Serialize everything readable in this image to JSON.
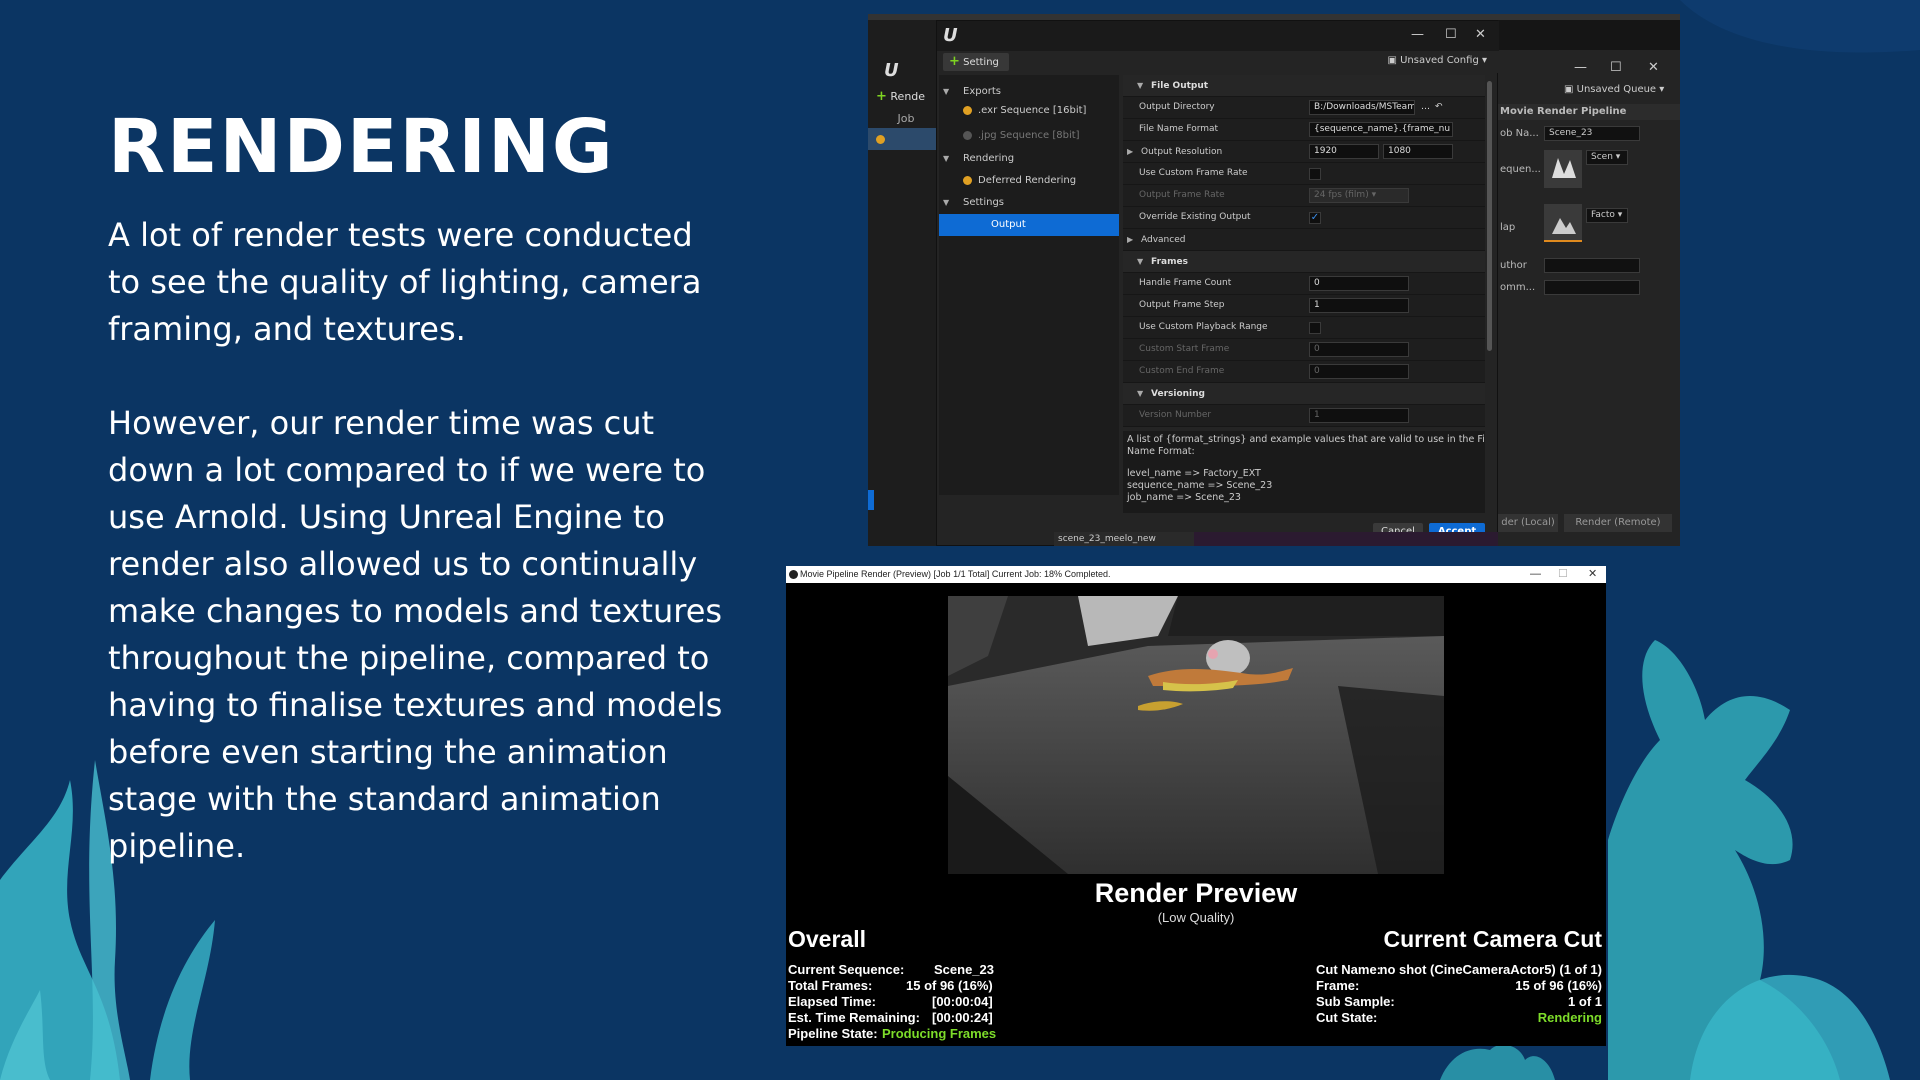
{
  "slide": {
    "title": "RENDERING",
    "paragraph1": "A lot of render tests were conducted to see the quality of lighting, camera framing, and textures.",
    "paragraph2": "However, our render time was cut down a lot compared to if we were to use Arnold. Using Unreal Engine to render also allowed us to continually make changes to models and textures throughout the pipeline, compared to having to finalise textures and models before even starting the animation stage with the standard animation pipeline."
  },
  "colors": {
    "background": "#0b3563",
    "accent": "#0e6bd4",
    "green": "#7ddc2a",
    "seaweed": "#3ab7c9"
  },
  "back_window": {
    "render_btn": "Rende",
    "job_header": "Job",
    "queue_label": "Unsaved Queue",
    "panel_title": "Movie Render Pipeline",
    "job_name_label": "ob Na...",
    "job_name_value": "Scene_23",
    "sequence_label": "equen...",
    "scene_dd": "Scen",
    "map_label": "lap",
    "factory_dd": "Facto",
    "author_label": "uthor",
    "comment_label": "omm...",
    "render_local": "der (Local)",
    "render_remote": "Render (Remote)",
    "bottom_text": "scene_23_meelo_new"
  },
  "dialog": {
    "setting_button": "Setting",
    "config_label": "Unsaved Config",
    "tree": {
      "exports": "Exports",
      "exr": ".exr Sequence [16bit]",
      "jpg": ".jpg Sequence [8bit]",
      "rendering": "Rendering",
      "deferred": "Deferred Rendering",
      "settings": "Settings",
      "output": "Output"
    },
    "props": {
      "file_output": "File Output",
      "output_directory": "Output Directory",
      "output_directory_value": "B:/Downloads/MSTeams/N",
      "file_name_format": "File Name Format",
      "file_name_format_value": "{sequence_name}.{frame_nu",
      "output_resolution": "Output Resolution",
      "res_w": "1920",
      "res_h": "1080",
      "use_custom_frame_rate": "Use Custom Frame Rate",
      "output_frame_rate": "Output Frame Rate",
      "output_frame_rate_value": "24 fps (film)",
      "override_existing_output": "Override Existing Output",
      "advanced": "Advanced",
      "frames": "Frames",
      "handle_frame_count": "Handle Frame Count",
      "handle_frame_count_value": "0",
      "output_frame_step": "Output Frame Step",
      "output_frame_step_value": "1",
      "use_custom_playback_range": "Use Custom Playback Range",
      "custom_start_frame": "Custom Start Frame",
      "custom_start_frame_value": "0",
      "custom_end_frame": "Custom End Frame",
      "custom_end_frame_value": "0",
      "versioning": "Versioning",
      "version_number": "Version Number",
      "version_number_value": "1"
    },
    "description": {
      "line1": "A list of {format_strings} and example values that are valid to use in the File",
      "line2": "Name Format:",
      "line3": "level_name => Factory_EXT",
      "line4": "sequence_name => Scene_23",
      "line5": "job_name => Scene_23"
    },
    "cancel": "Cancel",
    "accept": "Accept"
  },
  "preview": {
    "window_title": "Movie Pipeline Render (Preview) [Job 1/1 Total] Current Job: 18% Completed.",
    "title": "Render Preview",
    "subtitle": "(Low Quality)",
    "overall_heading": "Overall",
    "camera_heading": "Current Camera Cut",
    "overall": {
      "current_sequence_label": "Current Sequence:",
      "current_sequence_value": "Scene_23",
      "total_frames_label": "Total Frames:",
      "total_frames_value": "15 of 96 (16%)",
      "elapsed_label": "Elapsed Time:",
      "elapsed_value": "[00:00:04]",
      "remaining_label": "Est. Time Remaining:",
      "remaining_value": "[00:00:24]",
      "pipeline_state_label": "Pipeline State:",
      "pipeline_state_value": "Producing Frames"
    },
    "camera": {
      "cut_name_label": "Cut Name:",
      "cut_name_value": "no shot (CineCameraActor5) (1 of 1)",
      "frame_label": "Frame:",
      "frame_value": "15 of 96 (16%)",
      "sub_sample_label": "Sub Sample:",
      "sub_sample_value": "1 of 1",
      "cut_state_label": "Cut State:",
      "cut_state_value": "Rendering"
    }
  }
}
